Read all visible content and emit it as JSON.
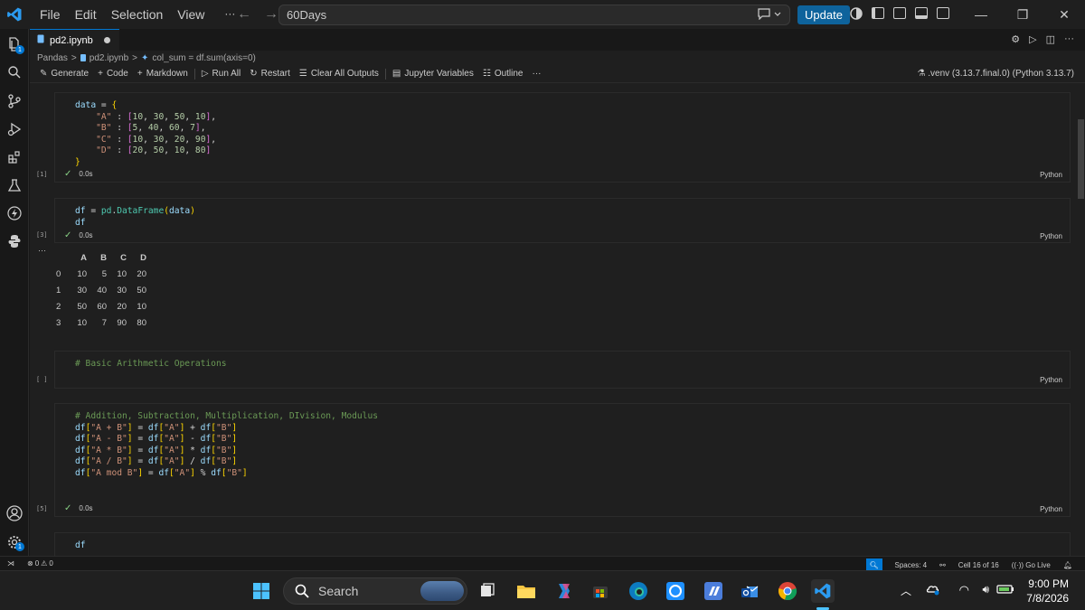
{
  "menu": [
    "File",
    "Edit",
    "Selection",
    "View",
    "···"
  ],
  "command_center": {
    "text": "60Days"
  },
  "update_button": "Update",
  "tab": {
    "label": "pd2.ipynb"
  },
  "breadcrumb": {
    "folder": "Pandas",
    "file": "pd2.ipynb",
    "symbol": "col_sum = df.sum(axis=0)"
  },
  "toolbar": {
    "generate": "Generate",
    "code": "Code",
    "markdown": "Markdown",
    "run_all": "Run All",
    "restart": "Restart",
    "clear_outputs": "Clear All Outputs",
    "jupyter_variables": "Jupyter Variables",
    "outline": "Outline",
    "more": "···",
    "kernel": ".venv (3.13.7.final.0) (Python 3.13.7)"
  },
  "cells": [
    {
      "exec": "[1]",
      "time": "0.0s",
      "lang": "Python"
    },
    {
      "exec": "[3]",
      "time": "0.0s",
      "lang": "Python"
    },
    {
      "exec": "[ ]",
      "lang": "Python"
    },
    {
      "exec": "[5]",
      "time": "0.0s",
      "lang": "Python"
    },
    {
      "code": "df"
    }
  ],
  "output": {
    "more": "···",
    "columns": [
      "A",
      "B",
      "C",
      "D"
    ],
    "rows": [
      {
        "index": "0",
        "values": [
          "10",
          "5",
          "10",
          "20"
        ]
      },
      {
        "index": "1",
        "values": [
          "30",
          "40",
          "30",
          "50"
        ]
      },
      {
        "index": "2",
        "values": [
          "50",
          "60",
          "20",
          "10"
        ]
      },
      {
        "index": "3",
        "values": [
          "10",
          "7",
          "90",
          "80"
        ]
      }
    ]
  },
  "statusbar": {
    "errors": "0",
    "warnings": "0",
    "spaces": "Spaces: 4",
    "cell": "Cell 16 of 16",
    "golive": "Go Live"
  },
  "taskbar": {
    "search_placeholder": "Search",
    "time": "9:00 PM",
    "date": "7/8/2026"
  }
}
